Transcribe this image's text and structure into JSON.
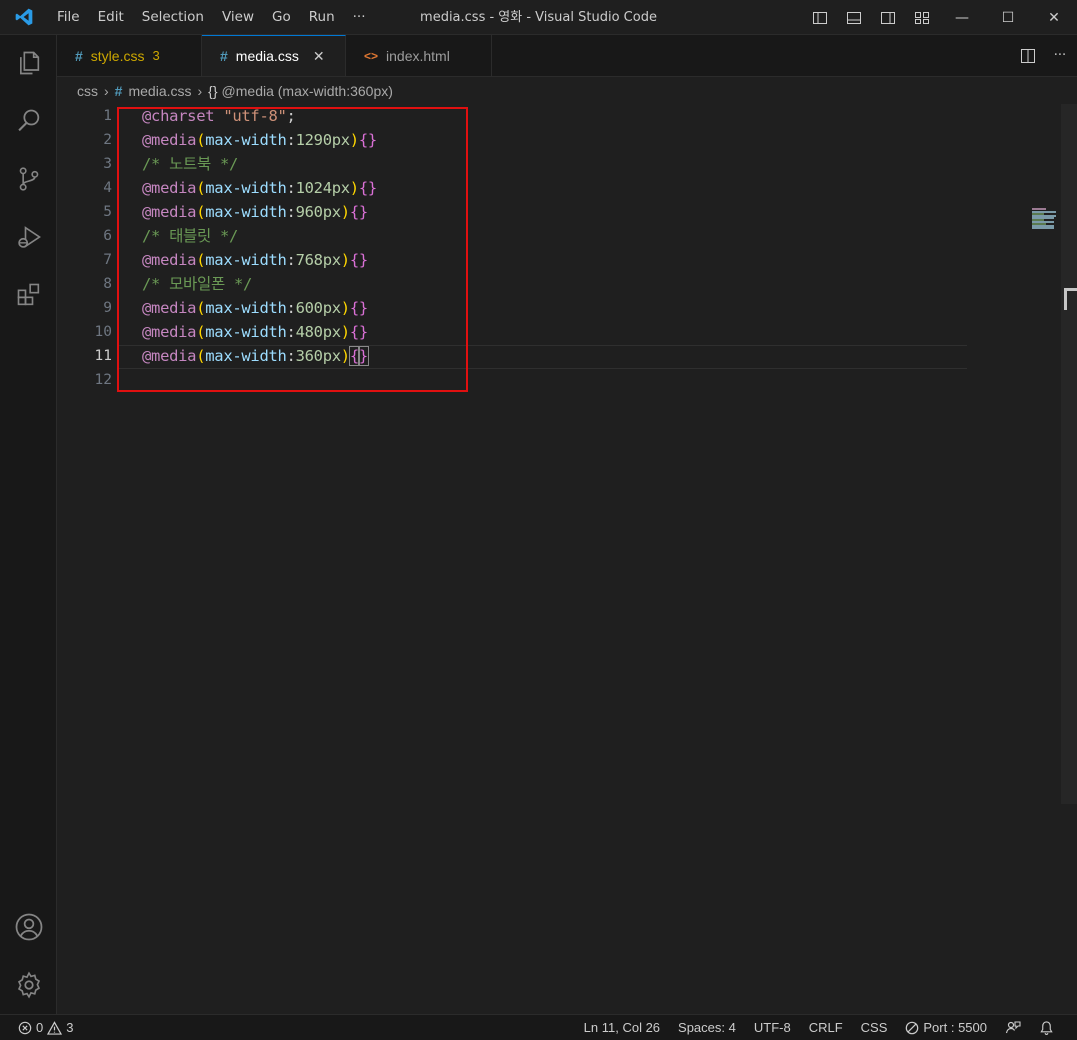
{
  "titlebar": {
    "menu": [
      "File",
      "Edit",
      "Selection",
      "View",
      "Go",
      "Run",
      "···"
    ],
    "window_title": "media.css - 영화 - Visual Studio Code",
    "minimize": "—",
    "maximize": "☐",
    "close": "✕"
  },
  "tabs": [
    {
      "icon": "#",
      "label": "style.css",
      "badge": "3",
      "active": false
    },
    {
      "icon": "#",
      "label": "media.css",
      "close": "✕",
      "active": true
    },
    {
      "icon": "<>",
      "label": "index.html",
      "active": false
    }
  ],
  "tab_actions": {
    "more": "···"
  },
  "breadcrumb": {
    "folder": "css",
    "sep1": "›",
    "file_icon": "#",
    "file": "media.css",
    "sep2": "›",
    "symbol_icon": "{}",
    "symbol": "@media (max-width:360px)"
  },
  "editor": {
    "line_numbers": [
      "1",
      "2",
      "3",
      "4",
      "5",
      "6",
      "7",
      "8",
      "9",
      "10",
      "11",
      "12"
    ],
    "current_line": 11,
    "lines": {
      "l1": {
        "at": "@charset",
        "str": "\"utf-8\"",
        "semi": ";"
      },
      "l2": {
        "at": "@media",
        "prop": "max-width",
        "colon": ":",
        "num": "1290px"
      },
      "l3": {
        "cmt": "/* 노트북 */"
      },
      "l4": {
        "at": "@media",
        "prop": "max-width",
        "colon": ":",
        "num": "1024px"
      },
      "l5": {
        "at": "@media",
        "prop": "max-width",
        "colon": ":",
        "num": "960px"
      },
      "l6": {
        "cmt": "/* 태블릿 */"
      },
      "l7": {
        "at": "@media",
        "prop": "max-width",
        "colon": ":",
        "num": "768px"
      },
      "l8": {
        "cmt": "/* 모바일폰 */"
      },
      "l9": {
        "at": "@media",
        "prop": "max-width",
        "colon": ":",
        "num": "600px"
      },
      "l10": {
        "at": "@media",
        "prop": "max-width",
        "colon": ":",
        "num": "480px"
      },
      "l11": {
        "at": "@media",
        "prop": "max-width",
        "colon": ":",
        "num": "360px"
      }
    },
    "tokens": {
      "open_paren": "(",
      "close_paren": ")",
      "open_brace": "{",
      "close_brace": "}"
    }
  },
  "statusbar": {
    "errors": "0",
    "warnings": "3",
    "position": "Ln 11, Col 26",
    "spaces": "Spaces: 4",
    "encoding": "UTF-8",
    "eol": "CRLF",
    "language": "CSS",
    "port": "Port : 5500"
  },
  "colors": {
    "accent": "#0078d4",
    "annotation_box": "#e01010",
    "at_rule": "#c586c0",
    "property": "#9cdcfe",
    "number": "#b5cea8",
    "comment": "#6a9955",
    "bracket": "#ffd700"
  }
}
